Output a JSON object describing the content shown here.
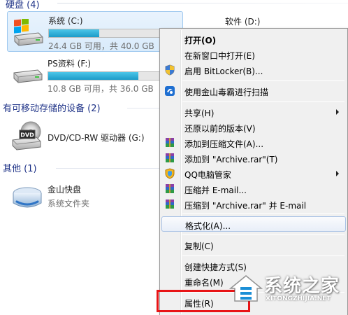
{
  "sections": {
    "hard_disks": {
      "title": "硬盘 (4)"
    },
    "removable": {
      "title": "有可移动存储的设备 (2)"
    },
    "other": {
      "title": "其他 (1)"
    }
  },
  "drives": {
    "c": {
      "name": "系统 (C:)",
      "info": "24.4 GB 可用，共 40.0 GB",
      "used_fraction": 0.39
    },
    "d": {
      "name": "软件 (D:)"
    },
    "f": {
      "name": "PS资料 (F:)",
      "info": "10.8 GB 可用，共 36.0 GB",
      "used_fraction": 0.7
    },
    "g": {
      "name": "DVD/CD-RW 驱动器 (G:)",
      "icon_text": "DVD"
    },
    "kuaipan": {
      "name": "金山快盘",
      "type": "系统文件夹"
    }
  },
  "context_menu": {
    "open": "打开(O)",
    "open_new_window": "在新窗口中打开(E)",
    "bitlocker": "启用 BitLocker(B)...",
    "scan": "使用金山毒霸进行扫描",
    "share": "共享(H)",
    "restore": "还原以前的版本(V)",
    "add_archive": "添加到压缩文件(A)...",
    "add_archive_rar": "添加到 \"Archive.rar\"(T)",
    "qq_manager": "QQ电脑管家",
    "compress_email": "压缩并 E-mail...",
    "compress_rar_email": "压缩到 \"Archive.rar\" 并 E-mail",
    "format": "格式化(A)...",
    "copy": "复制(C)",
    "create_shortcut": "创建快捷方式(S)",
    "rename": "重命名(M)",
    "properties": "属性(R)"
  },
  "watermark": {
    "title": "系统之家",
    "url": "XITONGZHIJIA.NET"
  },
  "colors": {
    "section_header": "#1e3287",
    "bar_fill": "#1c9bc8",
    "highlight": "#e81416",
    "menu_bg": "#f0f0f0"
  }
}
